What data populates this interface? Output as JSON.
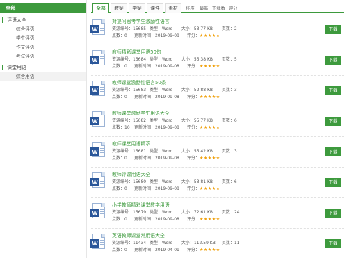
{
  "sidebar": {
    "all_label": "全部",
    "groups": [
      {
        "label": "评语大全",
        "items": [
          "综合评语",
          "学生评语",
          "作文评语",
          "考试评语"
        ]
      },
      {
        "label": "课堂用语",
        "items": [
          "综合用语"
        ]
      }
    ]
  },
  "tabs": [
    "全部",
    "教案",
    "学案",
    "课件",
    "素材"
  ],
  "sort_options": [
    "排序:",
    "最新",
    "下载数",
    "评分"
  ],
  "labels": {
    "id": "资源编号：",
    "type": "类型：",
    "size": "大小：",
    "pages": "页数：",
    "views": "点数：",
    "updated": "更新时间：",
    "rating": "评分：",
    "download": "下载"
  },
  "colors": {
    "accent": "#3d9a3d",
    "star": "#f0a20f",
    "word_blue": "#2a5699"
  },
  "resources": [
    {
      "title": "对提问思考学生激励性语言",
      "id": "15685",
      "type": "Word",
      "size": "53.77 KB",
      "pages": "2",
      "views": "0",
      "updated": "2019-09-08",
      "stars": "★★★★★",
      "icon": "word-doc-icon"
    },
    {
      "title": "教师精彩课堂用语50句",
      "id": "15684",
      "type": "Word",
      "size": "55.38 KB",
      "pages": "5",
      "views": "0",
      "updated": "2019-09-08",
      "stars": "★★★★★",
      "icon": "word-doc-icon"
    },
    {
      "title": "教师课堂激励性语言50条",
      "id": "15683",
      "type": "Word",
      "size": "52.88 KB",
      "pages": "3",
      "views": "0",
      "updated": "2019-09-08",
      "stars": "★★★★★",
      "icon": "word-doc-icon"
    },
    {
      "title": "教师课堂激励学生用语大全",
      "id": "15682",
      "type": "Word",
      "size": "55.77 KB",
      "pages": "6",
      "views": "10",
      "updated": "2019-09-08",
      "stars": "★★★★★",
      "icon": "word-doc-icon"
    },
    {
      "title": "教师课堂用语精萃",
      "id": "15681",
      "type": "Word",
      "size": "55.42 KB",
      "pages": "3",
      "views": "0",
      "updated": "2019-09-08",
      "stars": "★★★★★",
      "icon": "word-doc-icon"
    },
    {
      "title": "教师评课用语大全",
      "id": "15680",
      "type": "Word",
      "size": "53.81 KB",
      "pages": "6",
      "views": "0",
      "updated": "2019-09-08",
      "stars": "★★★★★",
      "icon": "word-doc-icon"
    },
    {
      "title": "小学教师精彩课堂教学用语",
      "id": "15679",
      "type": "Word",
      "size": "72.61 KB",
      "pages": "24",
      "views": "0",
      "updated": "2019-09-08",
      "stars": "★★★★★",
      "icon": "word-doc-icon"
    },
    {
      "title": "英语教师课堂常用语大全",
      "id": "11434",
      "type": "Word",
      "size": "112.59 KB",
      "pages": "11",
      "views": "0",
      "updated": "2019-04-01",
      "stars": "★★★★★",
      "icon": "word-doc-icon"
    }
  ]
}
